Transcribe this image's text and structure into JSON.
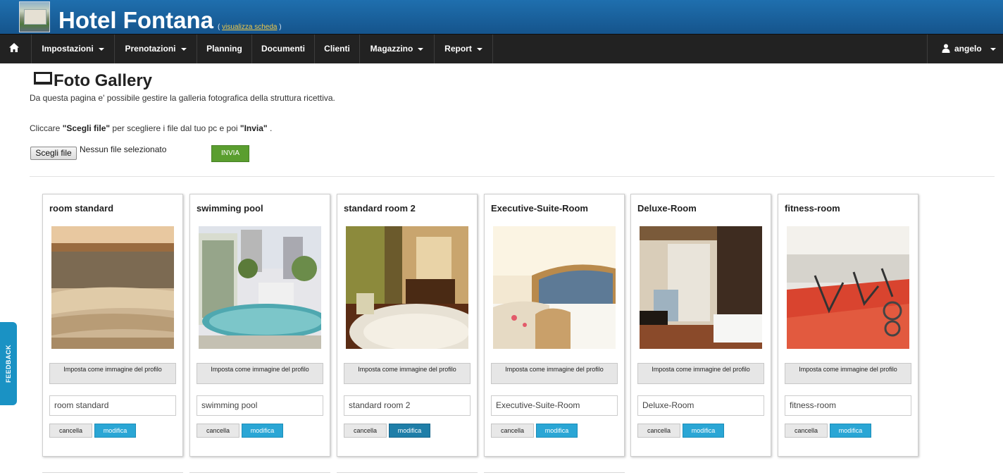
{
  "header": {
    "hotel_name": "Hotel Fontana",
    "view_link_prefix": "( ",
    "view_link": "visualizza scheda",
    "view_link_suffix": " )"
  },
  "nav": {
    "items": [
      {
        "label": "Impostazioni",
        "dropdown": true
      },
      {
        "label": "Prenotazioni",
        "dropdown": true
      },
      {
        "label": "Planning",
        "dropdown": false
      },
      {
        "label": "Documenti",
        "dropdown": false
      },
      {
        "label": "Clienti",
        "dropdown": false
      },
      {
        "label": "Magazzino",
        "dropdown": true
      },
      {
        "label": "Report",
        "dropdown": true
      }
    ],
    "user": "angelo"
  },
  "page": {
    "title": "Foto Gallery",
    "intro": "Da questa pagina e' possibile gestire la galleria fotografica della struttura ricettiva.",
    "instr_1": "Cliccare ",
    "instr_choose": "\"Scegli file\"",
    "instr_2": " per scegliere i file dal tuo pc e poi ",
    "instr_send": "\"Invia\"",
    "instr_3": " .",
    "file_button": "Scegli file",
    "file_status": "Nessun file selezionato",
    "send_button": "INVIA"
  },
  "gallery": {
    "set_profile_label": "Imposta come immagine del profilo",
    "delete_label": "cancella",
    "edit_label": "modifica",
    "items": [
      {
        "title": "room standard",
        "name_value": "room standard"
      },
      {
        "title": "swimming pool",
        "name_value": "swimming pool"
      },
      {
        "title": "standard room 2",
        "name_value": "standard room 2"
      },
      {
        "title": "Executive-Suite-Room",
        "name_value": "Executive-Suite-Room"
      },
      {
        "title": "Deluxe-Room",
        "name_value": "Deluxe-Room"
      },
      {
        "title": "fitness-room",
        "name_value": "fitness-room"
      }
    ]
  },
  "feedback": "FEEDBACK",
  "colors": {
    "header": "#1a63a0",
    "navbar": "#222222",
    "send_button": "#5a9e2f",
    "edit_button": "#2aa6d5",
    "feedback_tab": "#1a92c4"
  }
}
